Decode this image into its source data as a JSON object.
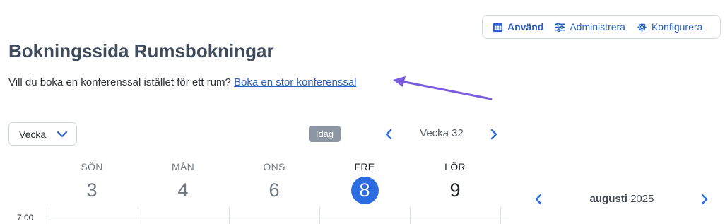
{
  "toolbar": {
    "items": [
      {
        "label": "Använd",
        "icon": "calendar-grid-icon",
        "active": true
      },
      {
        "label": "Administrera",
        "icon": "sliders-icon",
        "active": false
      },
      {
        "label": "Konfigurera",
        "icon": "gear-icon",
        "active": false
      }
    ]
  },
  "page": {
    "title": "Bokningssida Rumsbokningar",
    "intro_text": "Vill du boka en konferenssal istället för ett rum?",
    "intro_link": "Boka en stor konferenssal"
  },
  "calendar": {
    "view_select": {
      "value": "Vecka",
      "icon": "chevron-down-icon"
    },
    "today_label": "Idag",
    "week_label": "Vecka 32",
    "days": [
      {
        "name": "SÖN",
        "num": "3"
      },
      {
        "name": "MÅN",
        "num": "4"
      },
      {
        "name": "ONS",
        "num": "6"
      },
      {
        "name": "FRE",
        "num": "8",
        "today": true
      },
      {
        "name": "LÖR",
        "num": "9"
      }
    ],
    "times": [
      "7:00"
    ]
  },
  "mini_calendar": {
    "month": "augusti",
    "year": "2025"
  },
  "colors": {
    "accent": "#2b5fc4",
    "today_circle": "#2b6de0",
    "annotation_arrow": "#7b5ce0",
    "today_button": "#8d96a3",
    "title": "#3f4a5a"
  }
}
